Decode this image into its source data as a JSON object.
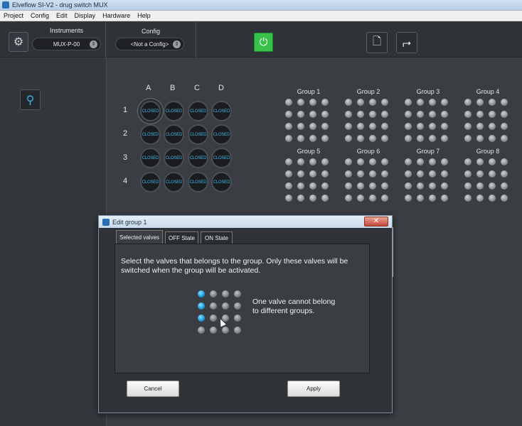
{
  "window": {
    "title": "Elveflow SI-V2   -   drug switch MUX"
  },
  "menu": [
    "Project",
    "Config",
    "Edit",
    "Display",
    "Hardware",
    "Help"
  ],
  "toolbar": {
    "instruments_label": "Instruments",
    "instrument_value": "MUX-P-00",
    "config_label": "Config",
    "config_value": "<Not a Config>"
  },
  "mux": {
    "columns": [
      "A",
      "B",
      "C",
      "D"
    ],
    "rows": [
      "1",
      "2",
      "3",
      "4"
    ],
    "valve_state": "CLOSED"
  },
  "groups": [
    "Group 1",
    "Group 2",
    "Group 3",
    "Group 4",
    "Group 5",
    "Group 6",
    "Group 7",
    "Group 8"
  ],
  "dialog": {
    "title": "Edit group 1",
    "close_label": "✕",
    "tabs": [
      "Selected valves",
      "OFF State",
      "ON State"
    ],
    "instructions": "Select the valves that belongs to the group. Only these valves will be switched when the group will be activated.",
    "note": "One valve cannot belong to different groups.",
    "selected_valves": [
      [
        1,
        0,
        0,
        0
      ],
      [
        1,
        0,
        0,
        0
      ],
      [
        1,
        0,
        0,
        0
      ],
      [
        0,
        0,
        0,
        0
      ]
    ],
    "cancel_label": "Cancel",
    "apply_label": "Apply"
  }
}
